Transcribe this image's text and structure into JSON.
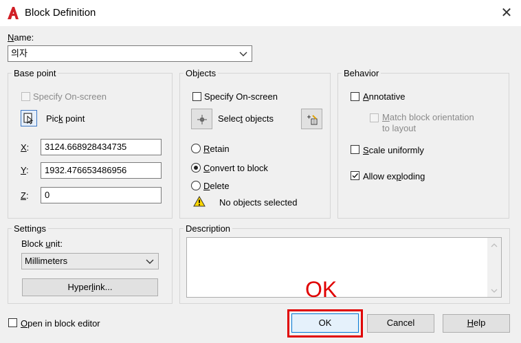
{
  "window": {
    "title": "Block Definition",
    "close_glyph": "✕"
  },
  "name": {
    "label": "Name:",
    "value": "의자"
  },
  "base_point": {
    "title": "Base point",
    "specify_onscreen": "Specify On-screen",
    "pick_point": "Pick point",
    "x_label": "X:",
    "x_value": "3124.668928434735",
    "y_label": "Y:",
    "y_value": "1932.476653486956",
    "z_label": "Z:",
    "z_value": "0"
  },
  "objects": {
    "title": "Objects",
    "specify_onscreen": "Specify On-screen",
    "select_objects": "Select objects",
    "retain": "Retain",
    "convert_to_block": "Convert to block",
    "delete": "Delete",
    "status": "No objects selected",
    "selected_option": "Convert to block"
  },
  "behavior": {
    "title": "Behavior",
    "annotative": "Annotative",
    "match_orientation_line1": "Match block orientation",
    "match_orientation_line2": "to layout",
    "scale_uniformly": "Scale uniformly",
    "allow_exploding": "Allow exploding",
    "allow_exploding_checked": true
  },
  "settings": {
    "title": "Settings",
    "block_unit_label": "Block unit:",
    "block_unit_value": "Millimeters",
    "hyperlink_button": "Hyperlink..."
  },
  "description": {
    "title": "Description",
    "value": ""
  },
  "footer": {
    "open_in_editor": "Open in block editor",
    "ok": "OK",
    "cancel": "Cancel",
    "help": "Help"
  },
  "annotation": {
    "text": "OK",
    "color": "#e00000"
  }
}
